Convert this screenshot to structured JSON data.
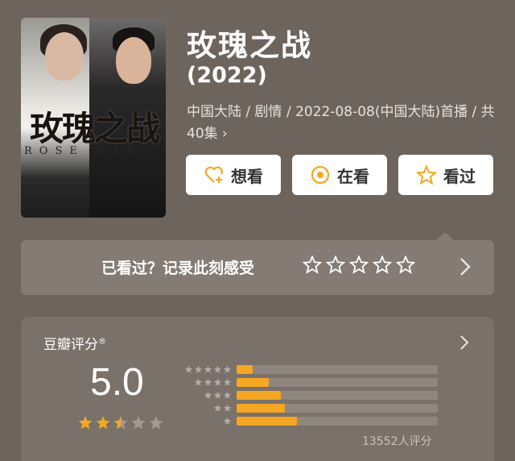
{
  "poster": {
    "title_text": "玫瑰之战",
    "sub_text": "ROSE WAR"
  },
  "movie": {
    "title": "玫瑰之战",
    "year": "(2022)",
    "meta": "中国大陆 / 剧情 / 2022-08-08(中国大陆)首播 / 共40集 ›"
  },
  "actions": [
    {
      "label": "想看",
      "icon": "heart-plus-icon"
    },
    {
      "label": "在看",
      "icon": "target-circle-icon"
    },
    {
      "label": "看过",
      "icon": "star-outline-icon"
    }
  ],
  "record": {
    "text": "已看过？记录此刻感受",
    "star_count": 5
  },
  "rating": {
    "label": "豆瓣评分",
    "mark": "®",
    "score": "5.0",
    "stars": 2.5,
    "distribution": [
      {
        "stars": 5,
        "fraction": 0.08
      },
      {
        "stars": 4,
        "fraction": 0.16
      },
      {
        "stars": 3,
        "fraction": 0.22
      },
      {
        "stars": 2,
        "fraction": 0.24
      },
      {
        "stars": 1,
        "fraction": 0.3
      }
    ],
    "count": "13552人评分"
  },
  "colors": {
    "accent": "#f5a623",
    "background": "#6d645d"
  }
}
